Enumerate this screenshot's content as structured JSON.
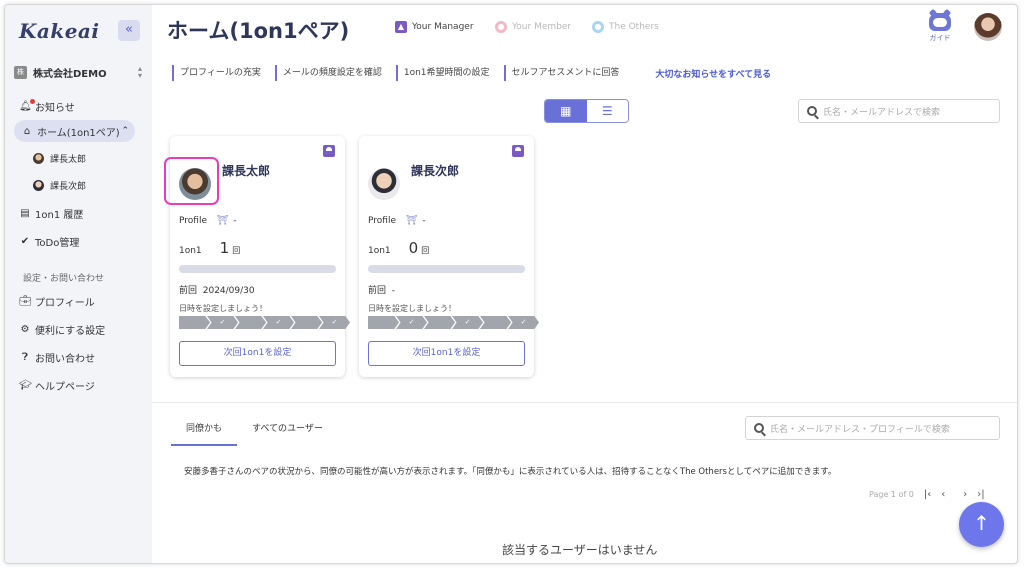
{
  "app": {
    "logo": "Kakeai"
  },
  "sidebar": {
    "collapse_icon": "double-chevron-left-icon",
    "company": {
      "badge": "株",
      "name": "株式会社DEMO"
    },
    "items": [
      {
        "label": "お知らせ",
        "icon": "bell-icon"
      },
      {
        "label": "ホーム(1on1ペア)",
        "icon": "home-icon"
      },
      {
        "label": "課長太郎",
        "icon": "avatar"
      },
      {
        "label": "課長次郎",
        "icon": "avatar"
      },
      {
        "label": "1on1 履歴",
        "icon": "history-icon"
      },
      {
        "label": "ToDo管理",
        "icon": "check-circle-icon"
      }
    ],
    "settings_section": "設定・お問い合わせ",
    "settings_items": [
      {
        "label": "プロフィール",
        "icon": "briefcase-icon"
      },
      {
        "label": "便利にする設定",
        "icon": "gear-icon"
      },
      {
        "label": "お問い合わせ",
        "icon": "question-icon"
      },
      {
        "label": "ヘルプページ",
        "icon": "graduation-cap-icon"
      }
    ]
  },
  "header": {
    "title": "ホーム(1on1ペア)",
    "roles": [
      {
        "label": "Your Manager",
        "color": "#7a5bc6",
        "active": true
      },
      {
        "label": "Your Member",
        "color": "#f2b8c6",
        "active": false
      },
      {
        "label": "The Others",
        "color": "#a9d6ef",
        "active": false
      }
    ],
    "guide_label": "ガイド"
  },
  "links": {
    "items": [
      "プロフィールの充実",
      "メールの頻度設定を確認",
      "1on1希望時間の設定",
      "セルフアセスメントに回答"
    ],
    "all_label": "大切なお知らせをすべて見る"
  },
  "search": {
    "placeholder": "氏名・メールアドレスで検索"
  },
  "cards": [
    {
      "name": "課長太郎",
      "profile_label": "Profile",
      "profile_value": "-",
      "count_label": "1on1",
      "count": "1",
      "count_unit": "回",
      "prev_label": "前回",
      "prev_value": "2024/09/30",
      "hint": "日時を設定しましょう！",
      "button": "次回1on1を設定"
    },
    {
      "name": "課長次郎",
      "profile_label": "Profile",
      "profile_value": "-",
      "count_label": "1on1",
      "count": "0",
      "count_unit": "回",
      "prev_label": "前回",
      "prev_value": "-",
      "hint": "日時を設定しましょう！",
      "button": "次回1on1を設定"
    }
  ],
  "bottom": {
    "tabs": [
      "同僚かも",
      "すべてのユーザー"
    ],
    "search_placeholder": "氏名・メールアドレス・プロフィールで検索",
    "description": "安藤多香子さんのペアの状況から、同僚の可能性が高い方が表示されます。「同僚かも」に表示されている人は、招待することなくThe Othersとしてペアに追加できます。",
    "pager": "Page 1 of 0",
    "empty": "該当するユーザーはいません"
  },
  "colors": {
    "accent": "#6970d8",
    "highlight": "#e83cc0",
    "fab": "#6e76ec"
  }
}
